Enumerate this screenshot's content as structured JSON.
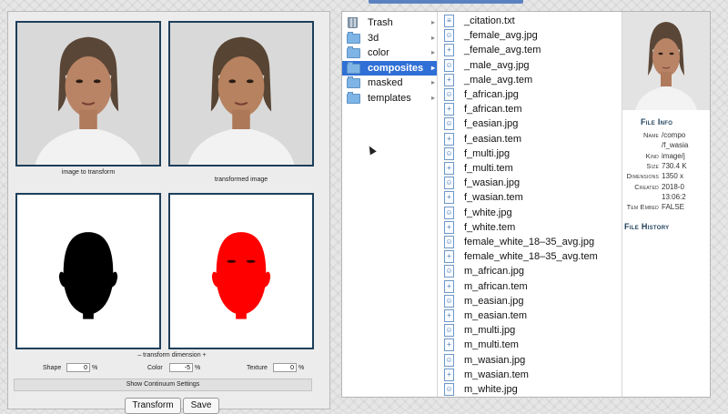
{
  "left_panel": {
    "captions": {
      "image_to_transform": "image to transform",
      "transformed_image": "transformed image",
      "transform_dimension": "– transform   dimension +"
    },
    "sliders": [
      {
        "label": "Shape",
        "value": "0",
        "unit": "%"
      },
      {
        "label": "Color",
        "value": "-5",
        "unit": "%"
      },
      {
        "label": "Texture",
        "value": "0",
        "unit": "%"
      }
    ],
    "continuum_label": "Show Continuum Settings",
    "buttons": {
      "transform": "Transform",
      "save": "Save"
    },
    "colors": {
      "mask_fill": "#000000",
      "mask_highlight": "#ff0000",
      "frame": "#1e3f5a"
    }
  },
  "finder": {
    "folders": [
      {
        "label": "Trash",
        "icon": "trash-icon",
        "selected": false
      },
      {
        "label": "3d",
        "icon": "folder-icon",
        "selected": false
      },
      {
        "label": "color",
        "icon": "folder-icon",
        "selected": false
      },
      {
        "label": "composites",
        "icon": "folder-icon",
        "selected": true
      },
      {
        "label": "masked",
        "icon": "folder-icon",
        "selected": false
      },
      {
        "label": "templates",
        "icon": "folder-icon",
        "selected": false
      }
    ],
    "files": [
      {
        "label": "_citation.txt",
        "kind": "text"
      },
      {
        "label": "_female_avg.jpg",
        "kind": "image"
      },
      {
        "label": "_female_avg.tem",
        "kind": "tem"
      },
      {
        "label": "_male_avg.jpg",
        "kind": "image"
      },
      {
        "label": "_male_avg.tem",
        "kind": "tem"
      },
      {
        "label": "f_african.jpg",
        "kind": "image"
      },
      {
        "label": "f_african.tem",
        "kind": "tem"
      },
      {
        "label": "f_easian.jpg",
        "kind": "image"
      },
      {
        "label": "f_easian.tem",
        "kind": "tem"
      },
      {
        "label": "f_multi.jpg",
        "kind": "image"
      },
      {
        "label": "f_multi.tem",
        "kind": "tem"
      },
      {
        "label": "f_wasian.jpg",
        "kind": "image"
      },
      {
        "label": "f_wasian.tem",
        "kind": "tem"
      },
      {
        "label": "f_white.jpg",
        "kind": "image"
      },
      {
        "label": "f_white.tem",
        "kind": "tem"
      },
      {
        "label": "female_white_18–35_avg.jpg",
        "kind": "image"
      },
      {
        "label": "female_white_18–35_avg.tem",
        "kind": "tem"
      },
      {
        "label": "m_african.jpg",
        "kind": "image"
      },
      {
        "label": "m_african.tem",
        "kind": "tem"
      },
      {
        "label": "m_easian.jpg",
        "kind": "image"
      },
      {
        "label": "m_easian.tem",
        "kind": "tem"
      },
      {
        "label": "m_multi.jpg",
        "kind": "image"
      },
      {
        "label": "m_multi.tem",
        "kind": "tem"
      },
      {
        "label": "m_wasian.jpg",
        "kind": "image"
      },
      {
        "label": "m_wasian.tem",
        "kind": "tem"
      },
      {
        "label": "m_white.jpg",
        "kind": "image"
      }
    ],
    "file_info": {
      "title": "File Info",
      "rows": [
        {
          "key": "Name",
          "value": "/compo"
        },
        {
          "key": "",
          "value": "/f_wasia"
        },
        {
          "key": "Kind",
          "value": "image/j"
        },
        {
          "key": "Size",
          "value": "730.4 K"
        },
        {
          "key": "Dimensions",
          "value": "1350 x"
        },
        {
          "key": "Created",
          "value": "2018-0"
        },
        {
          "key": "",
          "value": "13:06:2"
        },
        {
          "key": "Tem Embed",
          "value": "FALSE"
        }
      ],
      "history_title": "File History"
    },
    "colors": {
      "selection": "#2f6fd6",
      "icon_blue": "#7eb4e6"
    }
  }
}
